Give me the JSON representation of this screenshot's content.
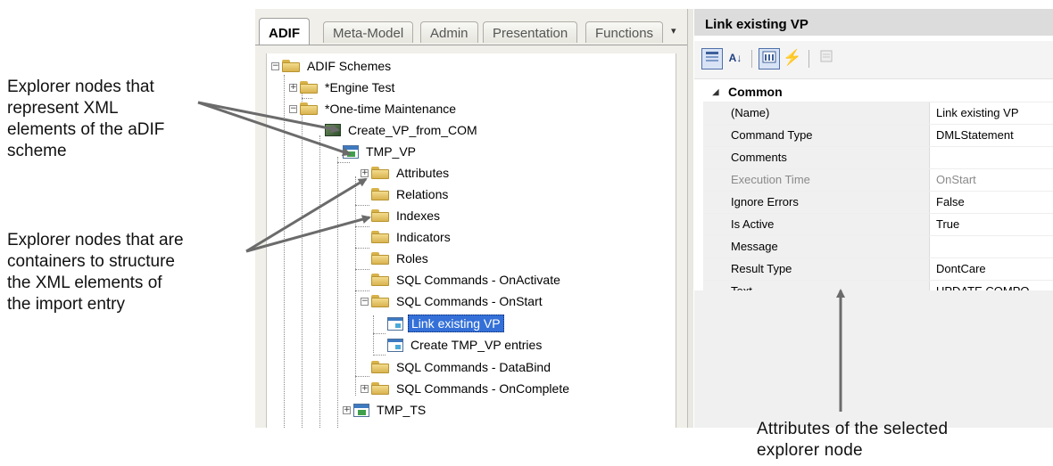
{
  "callouts": {
    "xml_elements": "Explorer nodes that\nrepresent XML\nelements of the aDIF\nscheme",
    "containers": "Explorer nodes that are\ncontainers to structure\nthe XML  elements of\nthe import entry",
    "attributes": "Attributes  of  the selected\nexplorer node"
  },
  "explorer": {
    "tabs": [
      {
        "label": "ADIF",
        "active": true
      },
      {
        "label": "Meta-Model"
      },
      {
        "label": "Admin"
      },
      {
        "label": "Presentation"
      },
      {
        "label": "Functions"
      }
    ],
    "tab_menu_glyph": "▾",
    "tree": [
      {
        "label": "ADIF Schemes",
        "icon": "folder-icon",
        "expander": "−"
      },
      {
        "label": "*Engine Test",
        "icon": "folder-icon",
        "expander": "+"
      },
      {
        "label": "*One-time Maintenance",
        "icon": "folder-icon",
        "expander": "−"
      },
      {
        "label": "Create_VP_from_COM",
        "icon": "cube-icon",
        "expander": "−"
      },
      {
        "label": "TMP_VP",
        "icon": "entity-icon",
        "expander": "−"
      },
      {
        "label": "Attributes",
        "icon": "folder-icon",
        "expander": "+"
      },
      {
        "label": "Relations",
        "icon": "folder-icon",
        "expander": ""
      },
      {
        "label": "Indexes",
        "icon": "folder-icon",
        "expander": ""
      },
      {
        "label": "Indicators",
        "icon": "folder-icon",
        "expander": ""
      },
      {
        "label": "Roles",
        "icon": "folder-icon",
        "expander": ""
      },
      {
        "label": "SQL Commands - OnActivate",
        "icon": "folder-icon",
        "expander": ""
      },
      {
        "label": "SQL Commands - OnStart",
        "icon": "folder-icon",
        "expander": "−"
      },
      {
        "label": "Link existing VP",
        "icon": "command-icon",
        "expander": "",
        "selected": true
      },
      {
        "label": "Create TMP_VP entries",
        "icon": "command-icon",
        "expander": ""
      },
      {
        "label": "SQL Commands - DataBind",
        "icon": "folder-icon",
        "expander": ""
      },
      {
        "label": "SQL Commands - OnComplete",
        "icon": "folder-icon",
        "expander": "+"
      },
      {
        "label": "TMP_TS",
        "icon": "entity-icon",
        "expander": "+"
      }
    ]
  },
  "properties": {
    "title": "Link existing VP",
    "toolbar": {
      "categorized_icon": "categorized-view-icon",
      "alphabetical_icon": "alphabetical-sort-icon",
      "alphabetical_glyph": "A↓",
      "properties_icon": "properties-page-icon",
      "events_icon": "lightning-events-icon",
      "events_glyph": "⚡",
      "property_pages_icon": "property-pages-icon"
    },
    "category": "Common",
    "category_glyph": "◢",
    "rows": [
      {
        "name": "(Name)",
        "value": "Link existing VP"
      },
      {
        "name": "Command Type",
        "value": "DMLStatement"
      },
      {
        "name": "Comments",
        "value": ""
      },
      {
        "name": "Execution Time",
        "value": "OnStart",
        "dim": true
      },
      {
        "name": "Ignore Errors",
        "value": "False"
      },
      {
        "name": "Is Active",
        "value": "True"
      },
      {
        "name": "Message",
        "value": ""
      },
      {
        "name": "Result Type",
        "value": "DontCare"
      },
      {
        "name": "Text",
        "value": "UPDATE COMPO"
      }
    ]
  }
}
